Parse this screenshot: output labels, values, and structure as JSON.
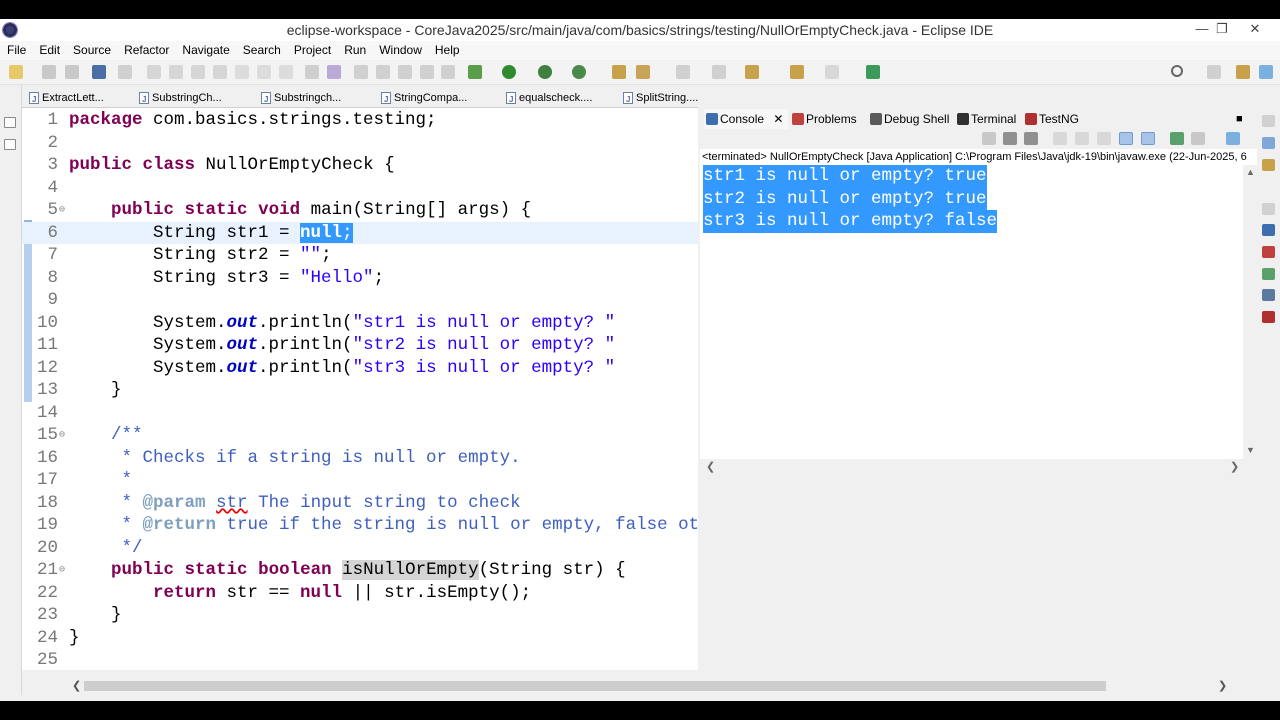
{
  "window": {
    "title": "eclipse-workspace - CoreJava2025/src/main/java/com/basics/strings/testing/NullOrEmptyCheck.java - Eclipse IDE"
  },
  "menu": [
    "File",
    "Edit",
    "Source",
    "Refactor",
    "Navigate",
    "Search",
    "Project",
    "Run",
    "Window",
    "Help"
  ],
  "editor_tabs": [
    "ExtractLett...",
    "SubstringCh...",
    "Substringch...",
    "StringCompa...",
    "equalscheck....",
    "SplitString...."
  ],
  "code": {
    "lines": [
      {
        "n": "1",
        "t": "package com.basics.strings.testing;"
      },
      {
        "n": "2",
        "t": ""
      },
      {
        "n": "3",
        "t": "public class NullOrEmptyCheck {"
      },
      {
        "n": "4",
        "t": ""
      },
      {
        "n": "5",
        "t": "    public static void main(String[] args) {"
      },
      {
        "n": "6",
        "t": "        String str1 = null;"
      },
      {
        "n": "7",
        "t": "        String str2 = \"\";"
      },
      {
        "n": "8",
        "t": "        String str3 = \"Hello\";"
      },
      {
        "n": "9",
        "t": ""
      },
      {
        "n": "10",
        "t": "        System.out.println(\"str1 is null or empty? \""
      },
      {
        "n": "11",
        "t": "        System.out.println(\"str2 is null or empty? \""
      },
      {
        "n": "12",
        "t": "        System.out.println(\"str3 is null or empty? \""
      },
      {
        "n": "13",
        "t": "    }"
      },
      {
        "n": "14",
        "t": ""
      },
      {
        "n": "15",
        "t": "    /**"
      },
      {
        "n": "16",
        "t": "     * Checks if a string is null or empty."
      },
      {
        "n": "17",
        "t": "     *"
      },
      {
        "n": "18",
        "t": "     * @param str The input string to check"
      },
      {
        "n": "19",
        "t": "     * @return true if the string is null or empty, false otherwise"
      },
      {
        "n": "20",
        "t": "     */"
      },
      {
        "n": "21",
        "t": "    public static boolean isNullOrEmpty(String str) {"
      },
      {
        "n": "22",
        "t": "        return str == null || str.isEmpty();"
      },
      {
        "n": "23",
        "t": "    }"
      },
      {
        "n": "24",
        "t": "}"
      },
      {
        "n": "25",
        "t": ""
      }
    ]
  },
  "console": {
    "tabs": [
      "Console",
      "Problems",
      "Debug Shell",
      "Terminal",
      "TestNG"
    ],
    "status": "<terminated> NullOrEmptyCheck [Java Application] C:\\Program Files\\Java\\jdk-19\\bin\\javaw.exe  (22-Jun-2025, 6",
    "output": [
      "str1 is null or empty? true",
      "str2 is null or empty? true",
      "str3 is null or empty? false"
    ]
  },
  "colors": {
    "selection": "#3399ff",
    "keyword": "#7f0055",
    "string": "#2a00ff",
    "javadoc": "#3f5fbf",
    "current_line": "#e8f2fe"
  }
}
